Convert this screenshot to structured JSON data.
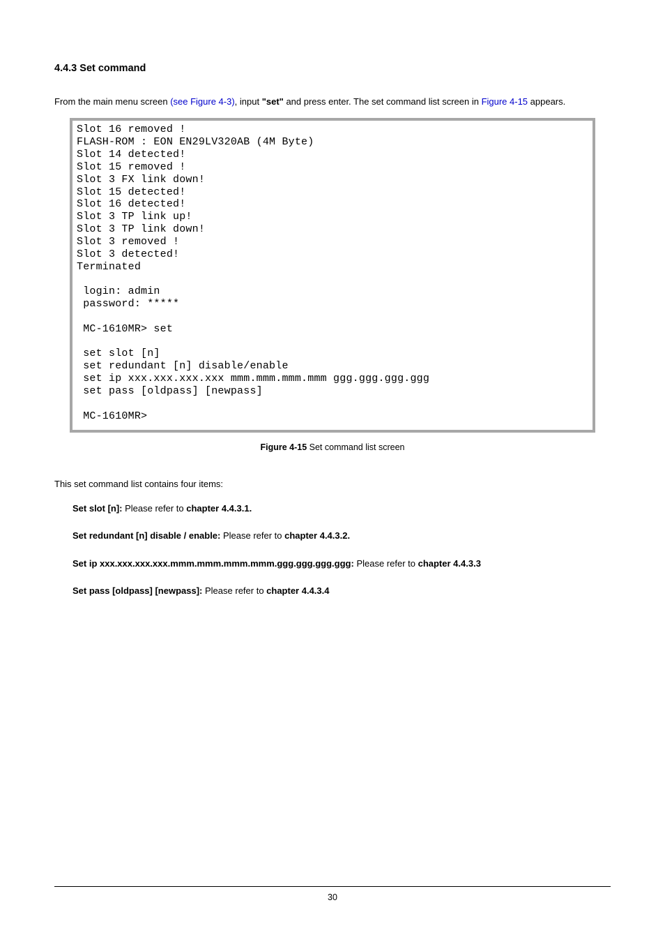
{
  "heading": "4.4.3 Set command",
  "intro": {
    "t1": "From the main menu screen ",
    "link1": "(see Figure 4-3)",
    "t2": ", input ",
    "bold": "\"set\"",
    "t3": " and press enter. The set command list screen in ",
    "link2": "Figure 4-15",
    "t4": " appears."
  },
  "terminal": "Slot 16 removed !\nFLASH-ROM : EON EN29LV320AB (4M Byte)\nSlot 14 detected!\nSlot 15 removed !\nSlot 3 FX link down!\nSlot 15 detected!\nSlot 16 detected!\nSlot 3 TP link up!\nSlot 3 TP link down!\nSlot 3 removed !\nSlot 3 detected!\nTerminated\n\n login: admin\n password: *****\n\n MC-1610MR> set\n\n set slot [n]\n set redundant [n] disable/enable\n set ip xxx.xxx.xxx.xxx mmm.mmm.mmm.mmm ggg.ggg.ggg.ggg\n set pass [oldpass] [newpass]\n\n MC-1610MR>",
  "caption": {
    "label": "Figure 4-15",
    "text": " Set command list screen"
  },
  "sub_intro": "This set command list contains four items:",
  "items": [
    {
      "b1": "Set slot [n]:  ",
      "t": "Please refer to ",
      "b2": "chapter 4.4.3.1."
    },
    {
      "b1": "Set redundant [n] disable / enable: ",
      "t": "Please refer to ",
      "b2": "chapter 4.4.3.2."
    },
    {
      "b1": "Set ip xxx.xxx.xxx.xxx.mmm.mmm.mmm.mmm.ggg.ggg.ggg.ggg: ",
      "t": "Please refer to ",
      "b2": "chapter 4.4.3.3"
    },
    {
      "b1": "Set pass [oldpass] [newpass]: ",
      "t": "Please refer to ",
      "b2": "chapter 4.4.3.4"
    }
  ],
  "page_number": "30"
}
